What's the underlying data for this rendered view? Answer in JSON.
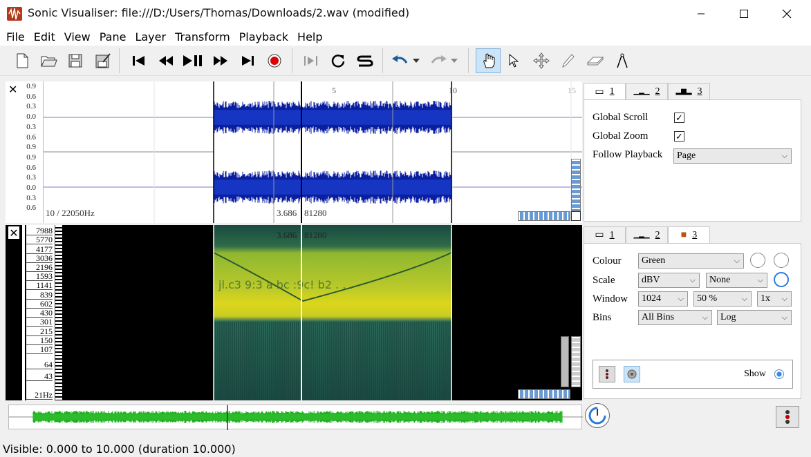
{
  "window": {
    "title": "Sonic Visualiser: file:///D:/Users/Thomas/Downloads/2.wav (modified)"
  },
  "menu": [
    "File",
    "Edit",
    "View",
    "Pane",
    "Layer",
    "Transform",
    "Playback",
    "Help"
  ],
  "pane1": {
    "y_labels": [
      "0.9",
      "0.6",
      "0.3",
      "0.0",
      "0.3",
      "0.6",
      "0.9",
      "0.9",
      "0.6",
      "0.3",
      "0.0",
      "0.3",
      "0.6"
    ],
    "time_ticks": [
      "5",
      "10",
      "15"
    ],
    "rate_label": "10 / 22050Hz",
    "cursor_time": "3.686",
    "cursor_frame": "81280"
  },
  "pane2": {
    "freq_labels": [
      "7988",
      "5770",
      "4177",
      "3036",
      "2196",
      "1593",
      "1141",
      "839",
      "602",
      "430",
      "301",
      "215",
      "150",
      "107",
      "64",
      "43",
      "21Hz"
    ],
    "cursor_time": "3.686",
    "cursor_frame": "81280"
  },
  "props1": {
    "tabs": [
      "1",
      "2",
      "3"
    ],
    "global_scroll_label": "Global Scroll",
    "global_zoom_label": "Global Zoom",
    "follow_playback_label": "Follow Playback",
    "follow_playback_value": "Page"
  },
  "props2": {
    "tabs": [
      "1",
      "2",
      "3"
    ],
    "colour_label": "Colour",
    "colour_value": "Green",
    "scale_label": "Scale",
    "scale_value": "dBV",
    "scale_value2": "None",
    "window_label": "Window",
    "window_value": "1024",
    "window_overlap": "50 %",
    "window_oversample": "1x",
    "bins_label": "Bins",
    "bins_value": "All Bins",
    "bins_scale": "Log",
    "show_label": "Show"
  },
  "status": "Visible: 0.000 to 10.000 (duration 10.000)",
  "colors": {
    "waveform": "#0a1ea0",
    "overview": "#20b020",
    "spectrogram_band": "#d7dc1a"
  }
}
